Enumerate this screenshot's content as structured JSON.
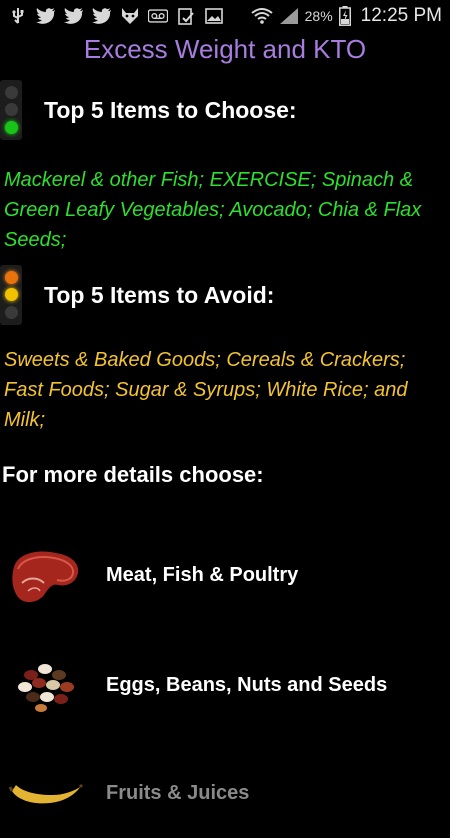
{
  "status_bar": {
    "left_icons": [
      "usb-icon",
      "twitter-icon",
      "twitter-icon",
      "twitter-icon",
      "wolf-icon",
      "voicemail-icon",
      "clipboard-check-icon",
      "image-icon"
    ],
    "battery_percent": "28%",
    "time": "12:25 PM"
  },
  "app": {
    "title": "Excess Weight and KTO"
  },
  "choose": {
    "title": "Top 5 Items to Choose:",
    "items": "Mackerel & other Fish; EXERCISE; Spinach & Green Leafy Vegetables; Avocado; Chia & Flax Seeds;",
    "color": "#2ee02e"
  },
  "avoid": {
    "title": "Top 5 Items to Avoid:",
    "items": "Sweets & Baked Goods; Cereals & Crackers; Fast Foods; Sugar & Syrups; White Rice; and Milk;",
    "color": "#f4c430"
  },
  "details": {
    "prompt": "For more details choose:",
    "categories": [
      {
        "label": "Meat, Fish & Poultry",
        "icon": "steak-icon"
      },
      {
        "label": "Eggs, Beans, Nuts and Seeds",
        "icon": "beans-icon"
      },
      {
        "label": "Fruits & Juices",
        "icon": "banana-icon"
      }
    ]
  },
  "colors": {
    "title": "#a77de0",
    "background": "#000000"
  }
}
